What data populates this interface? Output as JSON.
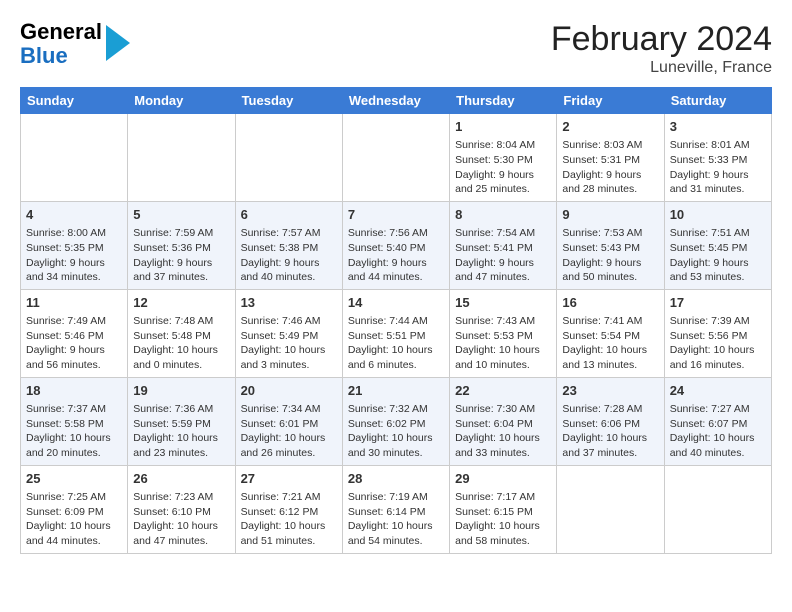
{
  "header": {
    "logo_general": "General",
    "logo_blue": "Blue",
    "month_year": "February 2024",
    "location": "Luneville, France"
  },
  "days_of_week": [
    "Sunday",
    "Monday",
    "Tuesday",
    "Wednesday",
    "Thursday",
    "Friday",
    "Saturday"
  ],
  "weeks": [
    [
      {
        "day": "",
        "info": ""
      },
      {
        "day": "",
        "info": ""
      },
      {
        "day": "",
        "info": ""
      },
      {
        "day": "",
        "info": ""
      },
      {
        "day": "1",
        "info": "Sunrise: 8:04 AM\nSunset: 5:30 PM\nDaylight: 9 hours\nand 25 minutes."
      },
      {
        "day": "2",
        "info": "Sunrise: 8:03 AM\nSunset: 5:31 PM\nDaylight: 9 hours\nand 28 minutes."
      },
      {
        "day": "3",
        "info": "Sunrise: 8:01 AM\nSunset: 5:33 PM\nDaylight: 9 hours\nand 31 minutes."
      }
    ],
    [
      {
        "day": "4",
        "info": "Sunrise: 8:00 AM\nSunset: 5:35 PM\nDaylight: 9 hours\nand 34 minutes."
      },
      {
        "day": "5",
        "info": "Sunrise: 7:59 AM\nSunset: 5:36 PM\nDaylight: 9 hours\nand 37 minutes."
      },
      {
        "day": "6",
        "info": "Sunrise: 7:57 AM\nSunset: 5:38 PM\nDaylight: 9 hours\nand 40 minutes."
      },
      {
        "day": "7",
        "info": "Sunrise: 7:56 AM\nSunset: 5:40 PM\nDaylight: 9 hours\nand 44 minutes."
      },
      {
        "day": "8",
        "info": "Sunrise: 7:54 AM\nSunset: 5:41 PM\nDaylight: 9 hours\nand 47 minutes."
      },
      {
        "day": "9",
        "info": "Sunrise: 7:53 AM\nSunset: 5:43 PM\nDaylight: 9 hours\nand 50 minutes."
      },
      {
        "day": "10",
        "info": "Sunrise: 7:51 AM\nSunset: 5:45 PM\nDaylight: 9 hours\nand 53 minutes."
      }
    ],
    [
      {
        "day": "11",
        "info": "Sunrise: 7:49 AM\nSunset: 5:46 PM\nDaylight: 9 hours\nand 56 minutes."
      },
      {
        "day": "12",
        "info": "Sunrise: 7:48 AM\nSunset: 5:48 PM\nDaylight: 10 hours\nand 0 minutes."
      },
      {
        "day": "13",
        "info": "Sunrise: 7:46 AM\nSunset: 5:49 PM\nDaylight: 10 hours\nand 3 minutes."
      },
      {
        "day": "14",
        "info": "Sunrise: 7:44 AM\nSunset: 5:51 PM\nDaylight: 10 hours\nand 6 minutes."
      },
      {
        "day": "15",
        "info": "Sunrise: 7:43 AM\nSunset: 5:53 PM\nDaylight: 10 hours\nand 10 minutes."
      },
      {
        "day": "16",
        "info": "Sunrise: 7:41 AM\nSunset: 5:54 PM\nDaylight: 10 hours\nand 13 minutes."
      },
      {
        "day": "17",
        "info": "Sunrise: 7:39 AM\nSunset: 5:56 PM\nDaylight: 10 hours\nand 16 minutes."
      }
    ],
    [
      {
        "day": "18",
        "info": "Sunrise: 7:37 AM\nSunset: 5:58 PM\nDaylight: 10 hours\nand 20 minutes."
      },
      {
        "day": "19",
        "info": "Sunrise: 7:36 AM\nSunset: 5:59 PM\nDaylight: 10 hours\nand 23 minutes."
      },
      {
        "day": "20",
        "info": "Sunrise: 7:34 AM\nSunset: 6:01 PM\nDaylight: 10 hours\nand 26 minutes."
      },
      {
        "day": "21",
        "info": "Sunrise: 7:32 AM\nSunset: 6:02 PM\nDaylight: 10 hours\nand 30 minutes."
      },
      {
        "day": "22",
        "info": "Sunrise: 7:30 AM\nSunset: 6:04 PM\nDaylight: 10 hours\nand 33 minutes."
      },
      {
        "day": "23",
        "info": "Sunrise: 7:28 AM\nSunset: 6:06 PM\nDaylight: 10 hours\nand 37 minutes."
      },
      {
        "day": "24",
        "info": "Sunrise: 7:27 AM\nSunset: 6:07 PM\nDaylight: 10 hours\nand 40 minutes."
      }
    ],
    [
      {
        "day": "25",
        "info": "Sunrise: 7:25 AM\nSunset: 6:09 PM\nDaylight: 10 hours\nand 44 minutes."
      },
      {
        "day": "26",
        "info": "Sunrise: 7:23 AM\nSunset: 6:10 PM\nDaylight: 10 hours\nand 47 minutes."
      },
      {
        "day": "27",
        "info": "Sunrise: 7:21 AM\nSunset: 6:12 PM\nDaylight: 10 hours\nand 51 minutes."
      },
      {
        "day": "28",
        "info": "Sunrise: 7:19 AM\nSunset: 6:14 PM\nDaylight: 10 hours\nand 54 minutes."
      },
      {
        "day": "29",
        "info": "Sunrise: 7:17 AM\nSunset: 6:15 PM\nDaylight: 10 hours\nand 58 minutes."
      },
      {
        "day": "",
        "info": ""
      },
      {
        "day": "",
        "info": ""
      }
    ]
  ]
}
